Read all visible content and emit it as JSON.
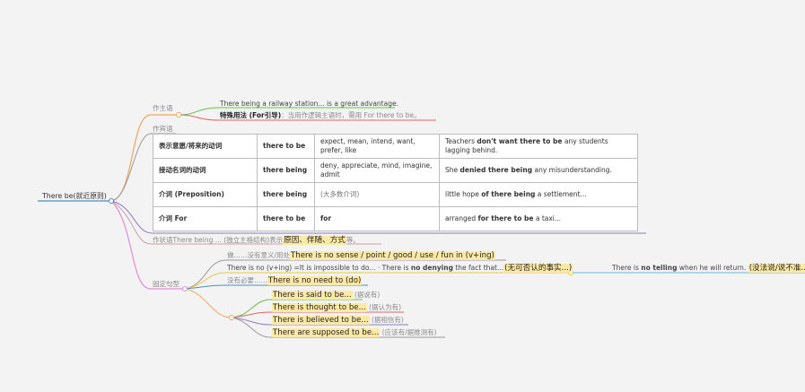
{
  "root": {
    "label": "There be(就近原则)"
  },
  "subject": {
    "label": "作主语",
    "line1": "There being a railway station... is a great advantage.",
    "line2_bold": "特殊用法 (For引导)",
    "line2_rest": "：当用作逻辑主语时，需用 For there to be。"
  },
  "object": {
    "label": "作宾语",
    "rows": [
      {
        "c1": "表示意愿/将来的动词",
        "c2": "there to be",
        "c3": "expect, mean, intend, want, prefer, like",
        "c4_pre": "Teachers ",
        "c4_bold": "don't want there to be",
        "c4_post": " any students lagging behind."
      },
      {
        "c1": "接动名词的动词",
        "c2": "there being",
        "c3": "deny, appreciate, mind, imagine, admit",
        "c4_pre": "She ",
        "c4_bold": "denied there being",
        "c4_post": " any misunderstanding."
      },
      {
        "c1": "介词 (Preposition)",
        "c2": "there being",
        "c3": "(大多数介词)",
        "c4_pre": "little hope ",
        "c4_bold": "of there being",
        "c4_post": " a settlement..."
      },
      {
        "c1": "介词 For",
        "c2": "there to be",
        "c3": "for",
        "c4_pre": "arranged ",
        "c4_bold": "for there to be",
        "c4_post": " a taxi..."
      }
    ]
  },
  "adverbial": {
    "pre": "作状语There being ... (独立主格结构)表示",
    "hl": "原因、伴随、方式",
    "post": "等。"
  },
  "fixed": {
    "label": "固定句型",
    "item1_pre": "做……没有意义/用处",
    "item1_hl": "There is no sense / point / good / use / fun in (v+ing)",
    "item2_pre": "There is no (v+ing) =It is impossible to do... · There is ",
    "item2_bold": "no denying",
    "item2_mid": " the fact that...",
    "item2_hl": "(无可否认的事实...)",
    "item2_child_pre": "There is ",
    "item2_child_bold": "no telling",
    "item2_child_mid": " when he will return. ",
    "item2_child_hl": "(没法说/说不准...)",
    "item3_pre": "没有必要……",
    "item3_hl": "There is no need to (do)",
    "said_hl": "There is said to be...",
    "said_note": " (据说有)",
    "thought_hl": "There is thought to be...",
    "thought_note": " (据认为有)",
    "believed_hl": "There is believed to be...",
    "believed_note": " (据相信有)",
    "supposed_hl": "There are supposed to be...",
    "supposed_note": " (应该有/据推测有)"
  },
  "colors": {
    "orange": "#f2a65a",
    "blue": "#4a90c2",
    "gray": "#9a9a9a",
    "purple": "#8e7cc3",
    "pink": "#e58ad6",
    "green": "#6abf4b",
    "red": "#e06666",
    "yellow": "#e7c84a",
    "cyan": "#5bc0de",
    "highlight": "#fde9a6"
  }
}
